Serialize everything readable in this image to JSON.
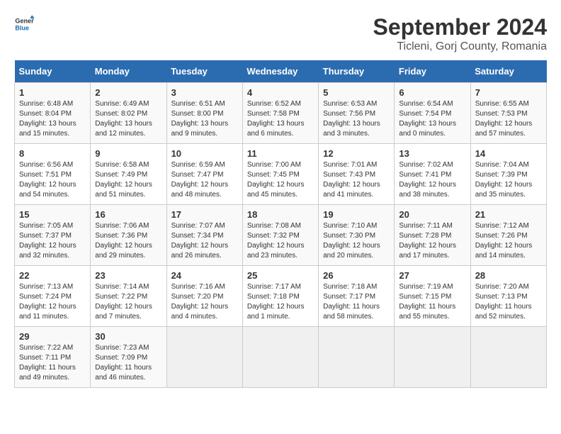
{
  "header": {
    "logo_line1": "General",
    "logo_line2": "Blue",
    "title": "September 2024",
    "subtitle": "Ticleni, Gorj County, Romania"
  },
  "calendar": {
    "days_of_week": [
      "Sunday",
      "Monday",
      "Tuesday",
      "Wednesday",
      "Thursday",
      "Friday",
      "Saturday"
    ],
    "weeks": [
      [
        {
          "day": "",
          "info": ""
        },
        {
          "day": "2",
          "info": "Sunrise: 6:49 AM\nSunset: 8:02 PM\nDaylight: 13 hours\nand 12 minutes."
        },
        {
          "day": "3",
          "info": "Sunrise: 6:51 AM\nSunset: 8:00 PM\nDaylight: 13 hours\nand 9 minutes."
        },
        {
          "day": "4",
          "info": "Sunrise: 6:52 AM\nSunset: 7:58 PM\nDaylight: 13 hours\nand 6 minutes."
        },
        {
          "day": "5",
          "info": "Sunrise: 6:53 AM\nSunset: 7:56 PM\nDaylight: 13 hours\nand 3 minutes."
        },
        {
          "day": "6",
          "info": "Sunrise: 6:54 AM\nSunset: 7:54 PM\nDaylight: 13 hours\nand 0 minutes."
        },
        {
          "day": "7",
          "info": "Sunrise: 6:55 AM\nSunset: 7:53 PM\nDaylight: 12 hours\nand 57 minutes."
        }
      ],
      [
        {
          "day": "8",
          "info": "Sunrise: 6:56 AM\nSunset: 7:51 PM\nDaylight: 12 hours\nand 54 minutes."
        },
        {
          "day": "9",
          "info": "Sunrise: 6:58 AM\nSunset: 7:49 PM\nDaylight: 12 hours\nand 51 minutes."
        },
        {
          "day": "10",
          "info": "Sunrise: 6:59 AM\nSunset: 7:47 PM\nDaylight: 12 hours\nand 48 minutes."
        },
        {
          "day": "11",
          "info": "Sunrise: 7:00 AM\nSunset: 7:45 PM\nDaylight: 12 hours\nand 45 minutes."
        },
        {
          "day": "12",
          "info": "Sunrise: 7:01 AM\nSunset: 7:43 PM\nDaylight: 12 hours\nand 41 minutes."
        },
        {
          "day": "13",
          "info": "Sunrise: 7:02 AM\nSunset: 7:41 PM\nDaylight: 12 hours\nand 38 minutes."
        },
        {
          "day": "14",
          "info": "Sunrise: 7:04 AM\nSunset: 7:39 PM\nDaylight: 12 hours\nand 35 minutes."
        }
      ],
      [
        {
          "day": "15",
          "info": "Sunrise: 7:05 AM\nSunset: 7:37 PM\nDaylight: 12 hours\nand 32 minutes."
        },
        {
          "day": "16",
          "info": "Sunrise: 7:06 AM\nSunset: 7:36 PM\nDaylight: 12 hours\nand 29 minutes."
        },
        {
          "day": "17",
          "info": "Sunrise: 7:07 AM\nSunset: 7:34 PM\nDaylight: 12 hours\nand 26 minutes."
        },
        {
          "day": "18",
          "info": "Sunrise: 7:08 AM\nSunset: 7:32 PM\nDaylight: 12 hours\nand 23 minutes."
        },
        {
          "day": "19",
          "info": "Sunrise: 7:10 AM\nSunset: 7:30 PM\nDaylight: 12 hours\nand 20 minutes."
        },
        {
          "day": "20",
          "info": "Sunrise: 7:11 AM\nSunset: 7:28 PM\nDaylight: 12 hours\nand 17 minutes."
        },
        {
          "day": "21",
          "info": "Sunrise: 7:12 AM\nSunset: 7:26 PM\nDaylight: 12 hours\nand 14 minutes."
        }
      ],
      [
        {
          "day": "22",
          "info": "Sunrise: 7:13 AM\nSunset: 7:24 PM\nDaylight: 12 hours\nand 11 minutes."
        },
        {
          "day": "23",
          "info": "Sunrise: 7:14 AM\nSunset: 7:22 PM\nDaylight: 12 hours\nand 7 minutes."
        },
        {
          "day": "24",
          "info": "Sunrise: 7:16 AM\nSunset: 7:20 PM\nDaylight: 12 hours\nand 4 minutes."
        },
        {
          "day": "25",
          "info": "Sunrise: 7:17 AM\nSunset: 7:18 PM\nDaylight: 12 hours\nand 1 minute."
        },
        {
          "day": "26",
          "info": "Sunrise: 7:18 AM\nSunset: 7:17 PM\nDaylight: 11 hours\nand 58 minutes."
        },
        {
          "day": "27",
          "info": "Sunrise: 7:19 AM\nSunset: 7:15 PM\nDaylight: 11 hours\nand 55 minutes."
        },
        {
          "day": "28",
          "info": "Sunrise: 7:20 AM\nSunset: 7:13 PM\nDaylight: 11 hours\nand 52 minutes."
        }
      ],
      [
        {
          "day": "29",
          "info": "Sunrise: 7:22 AM\nSunset: 7:11 PM\nDaylight: 11 hours\nand 49 minutes."
        },
        {
          "day": "30",
          "info": "Sunrise: 7:23 AM\nSunset: 7:09 PM\nDaylight: 11 hours\nand 46 minutes."
        },
        {
          "day": "",
          "info": ""
        },
        {
          "day": "",
          "info": ""
        },
        {
          "day": "",
          "info": ""
        },
        {
          "day": "",
          "info": ""
        },
        {
          "day": "",
          "info": ""
        }
      ]
    ],
    "week1_sunday": {
      "day": "1",
      "info": "Sunrise: 6:48 AM\nSunset: 8:04 PM\nDaylight: 13 hours\nand 15 minutes."
    }
  }
}
